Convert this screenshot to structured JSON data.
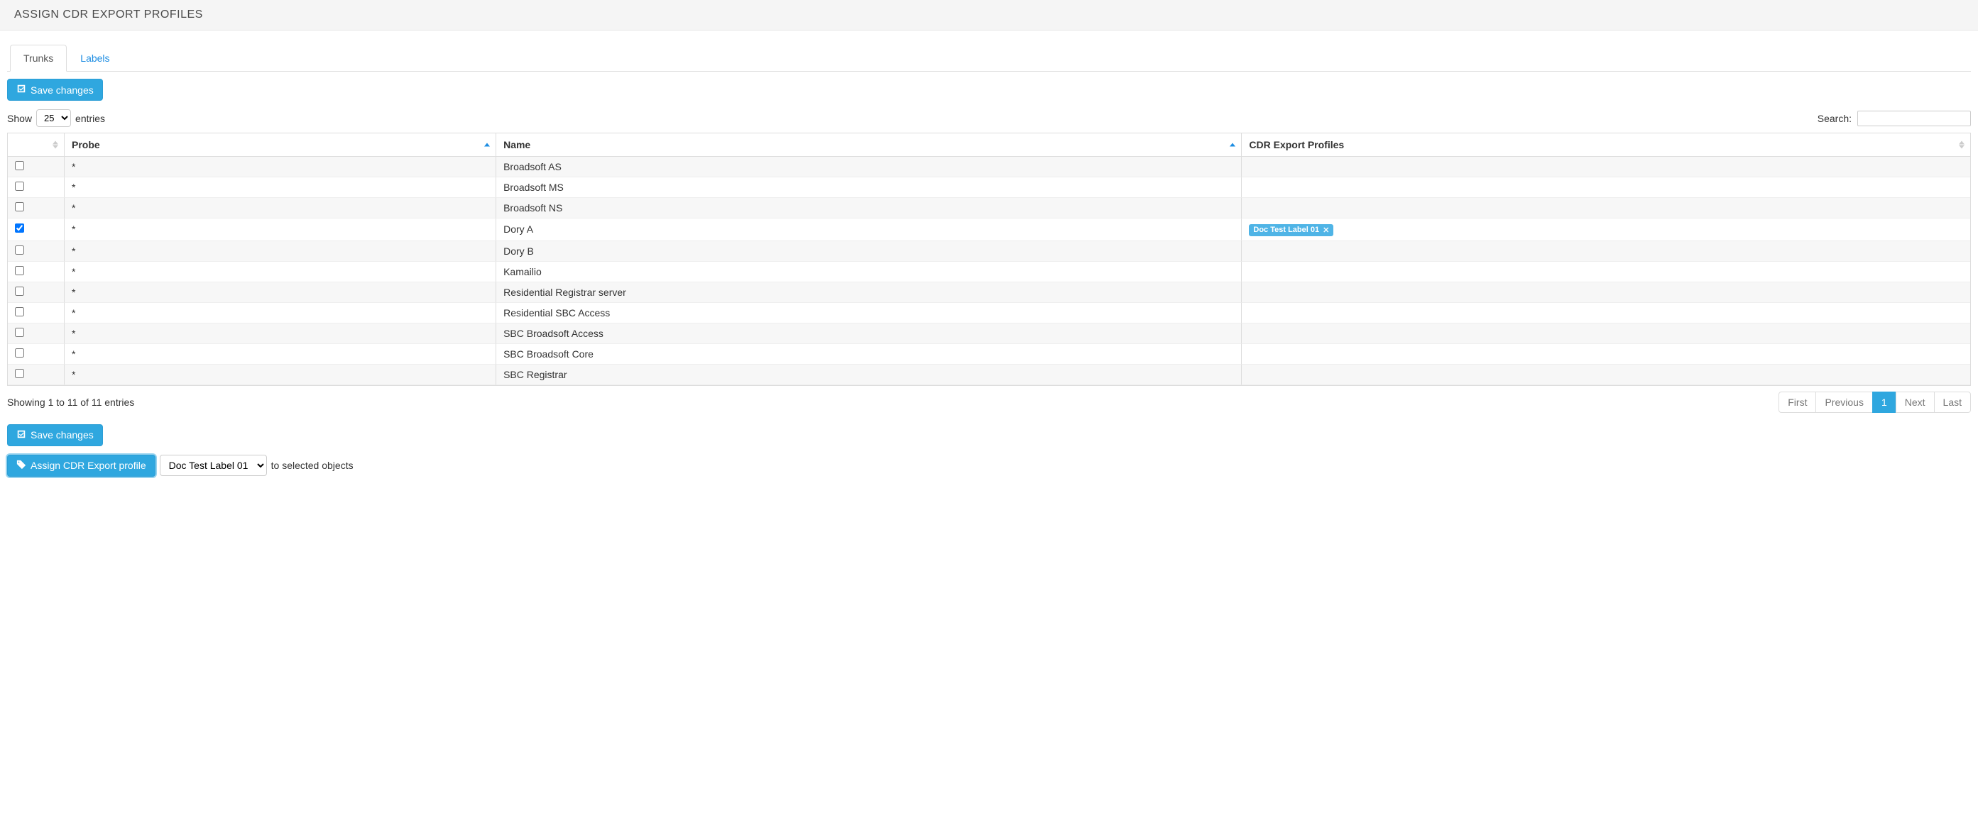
{
  "header": {
    "title": "ASSIGN CDR EXPORT PROFILES"
  },
  "tabs": [
    {
      "label": "Trunks",
      "active": true
    },
    {
      "label": "Labels",
      "active": false
    }
  ],
  "buttons": {
    "save_changes": "Save changes",
    "assign_profile": "Assign CDR Export profile"
  },
  "length": {
    "show": "Show",
    "entries": "entries",
    "value": "25",
    "options": [
      "25"
    ]
  },
  "search": {
    "label": "Search:",
    "value": ""
  },
  "columns": {
    "checkbox": "",
    "probe": "Probe",
    "name": "Name",
    "profiles": "CDR Export Profiles"
  },
  "rows": [
    {
      "checked": false,
      "probe": "*",
      "name": "Broadsoft AS",
      "profiles": []
    },
    {
      "checked": false,
      "probe": "*",
      "name": "Broadsoft MS",
      "profiles": []
    },
    {
      "checked": false,
      "probe": "*",
      "name": "Broadsoft NS",
      "profiles": []
    },
    {
      "checked": true,
      "probe": "*",
      "name": "Dory A",
      "profiles": [
        "Doc Test Label 01"
      ]
    },
    {
      "checked": false,
      "probe": "*",
      "name": "Dory B",
      "profiles": []
    },
    {
      "checked": false,
      "probe": "*",
      "name": "Kamailio",
      "profiles": []
    },
    {
      "checked": false,
      "probe": "*",
      "name": "Residential Registrar server",
      "profiles": []
    },
    {
      "checked": false,
      "probe": "*",
      "name": "Residential SBC Access",
      "profiles": []
    },
    {
      "checked": false,
      "probe": "*",
      "name": "SBC Broadsoft Access",
      "profiles": []
    },
    {
      "checked": false,
      "probe": "*",
      "name": "SBC Broadsoft Core",
      "profiles": []
    },
    {
      "checked": false,
      "probe": "*",
      "name": "SBC Registrar",
      "profiles": []
    }
  ],
  "info": "Showing 1 to 11 of 11 entries",
  "pagination": {
    "first": "First",
    "previous": "Previous",
    "page": "1",
    "next": "Next",
    "last": "Last"
  },
  "assign": {
    "dropdown_value": "Doc Test Label 01",
    "suffix": "to selected objects"
  }
}
